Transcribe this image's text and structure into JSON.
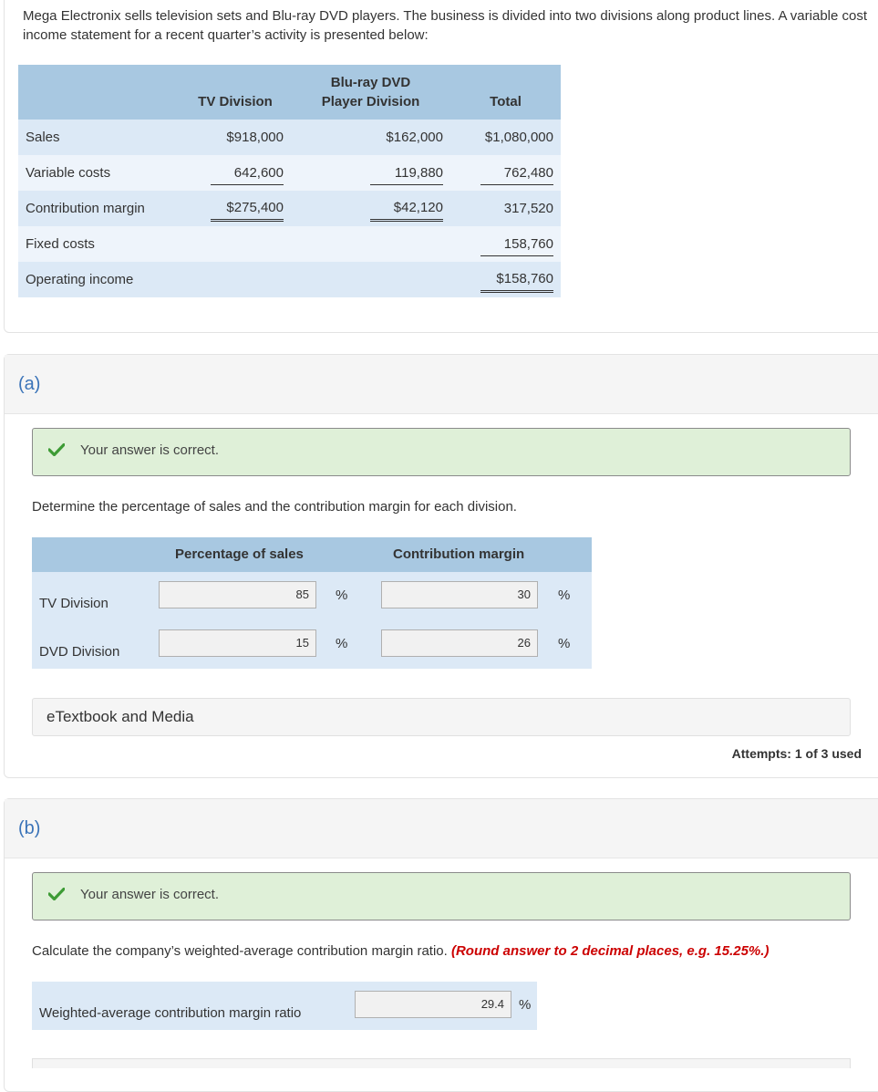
{
  "intro": "Mega Electronix sells television sets and Blu-ray DVD players. The business is divided into two divisions along product lines. A variable cost income statement for a recent quarter’s activity is presented below:",
  "statement": {
    "headers": {
      "tv": "TV Division",
      "blu1": "Blu-ray DVD",
      "blu2": "Player Division",
      "total": "Total"
    },
    "rows": [
      {
        "label": "Sales",
        "tv": "$918,000",
        "blu": "$162,000",
        "total": "$1,080,000"
      },
      {
        "label": "Variable costs",
        "tv": "642,600",
        "blu": "119,880",
        "total": "762,480"
      },
      {
        "label": "Contribution margin",
        "tv": "$275,400",
        "blu": "$42,120",
        "total": "317,520"
      },
      {
        "label": "Fixed costs",
        "tv": "",
        "blu": "",
        "total": "158,760"
      },
      {
        "label": "Operating income",
        "tv": "",
        "blu": "",
        "total": "$158,760"
      }
    ]
  },
  "part_a": {
    "letter": "(a)",
    "status": "Your answer is correct.",
    "question": "Determine the percentage of sales and the contribution margin for each division.",
    "col_pct": "Percentage of sales",
    "col_cm": "Contribution margin",
    "rows": [
      {
        "label": "TV Division",
        "pct": "85",
        "cm": "30",
        "unit": "%"
      },
      {
        "label": "DVD Division",
        "pct": "15",
        "cm": "26",
        "unit": "%"
      }
    ],
    "media": "eTextbook and Media",
    "attempts": "Attempts: 1 of 3 used"
  },
  "part_b": {
    "letter": "(b)",
    "status": "Your answer is correct.",
    "question": "Calculate the company’s weighted-average contribution margin ratio.",
    "note": "(Round answer to 2 decimal places, e.g. 15.25%.)",
    "label": "Weighted-average contribution margin ratio",
    "value": "29.4",
    "unit": "%"
  },
  "colors": {
    "header": "#a8c8e1",
    "row_dark": "#dce9f6",
    "row_light": "#eef4fb",
    "success": "#dff0d8",
    "check": "#3d9b35",
    "letter": "#3a73b8"
  },
  "icons": {
    "check": "check-icon"
  }
}
